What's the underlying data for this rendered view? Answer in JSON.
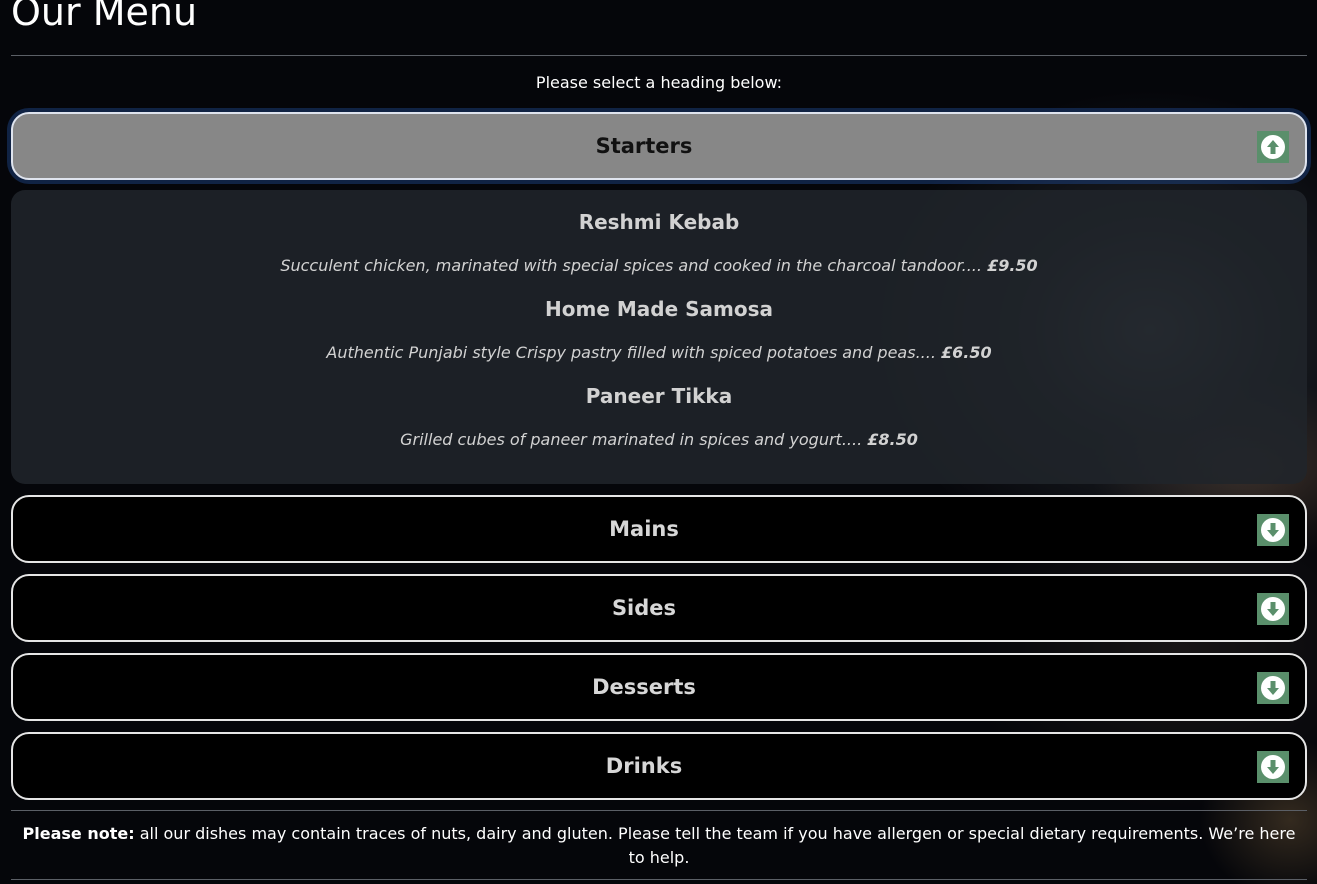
{
  "page_title": "Our Menu",
  "intro_text": "Please select a heading below:",
  "sections": [
    {
      "label": "Starters",
      "expanded": true,
      "toggle_icon": "arrow-up-circle-icon",
      "items": [
        {
          "name": "Reshmi Kebab",
          "description": "Succulent chicken, marinated with special spices and cooked in the charcoal tandoor....",
          "price": "£9.50"
        },
        {
          "name": "Home Made Samosa",
          "description": "Authentic Punjabi style Crispy pastry filled with spiced potatoes and peas....",
          "price": "£6.50"
        },
        {
          "name": "Paneer Tikka",
          "description": "Grilled cubes of paneer marinated in spices and yogurt....",
          "price": "£8.50"
        }
      ]
    },
    {
      "label": "Mains",
      "expanded": false,
      "toggle_icon": "arrow-down-circle-icon"
    },
    {
      "label": "Sides",
      "expanded": false,
      "toggle_icon": "arrow-down-circle-icon"
    },
    {
      "label": "Desserts",
      "expanded": false,
      "toggle_icon": "arrow-down-circle-icon"
    },
    {
      "label": "Drinks",
      "expanded": false,
      "toggle_icon": "arrow-down-circle-icon"
    }
  ],
  "note": {
    "prefix": "Please note:",
    "text": " all our dishes may contain traces of nuts, dairy and gluten. Please tell the team if you have allergen or special dietary requirements. We’re here to help."
  },
  "colors": {
    "accent_button": "#5a8f6b",
    "open_header_bg": "#878787",
    "panel_bg": "#20242a",
    "page_bg": "#05060a"
  }
}
